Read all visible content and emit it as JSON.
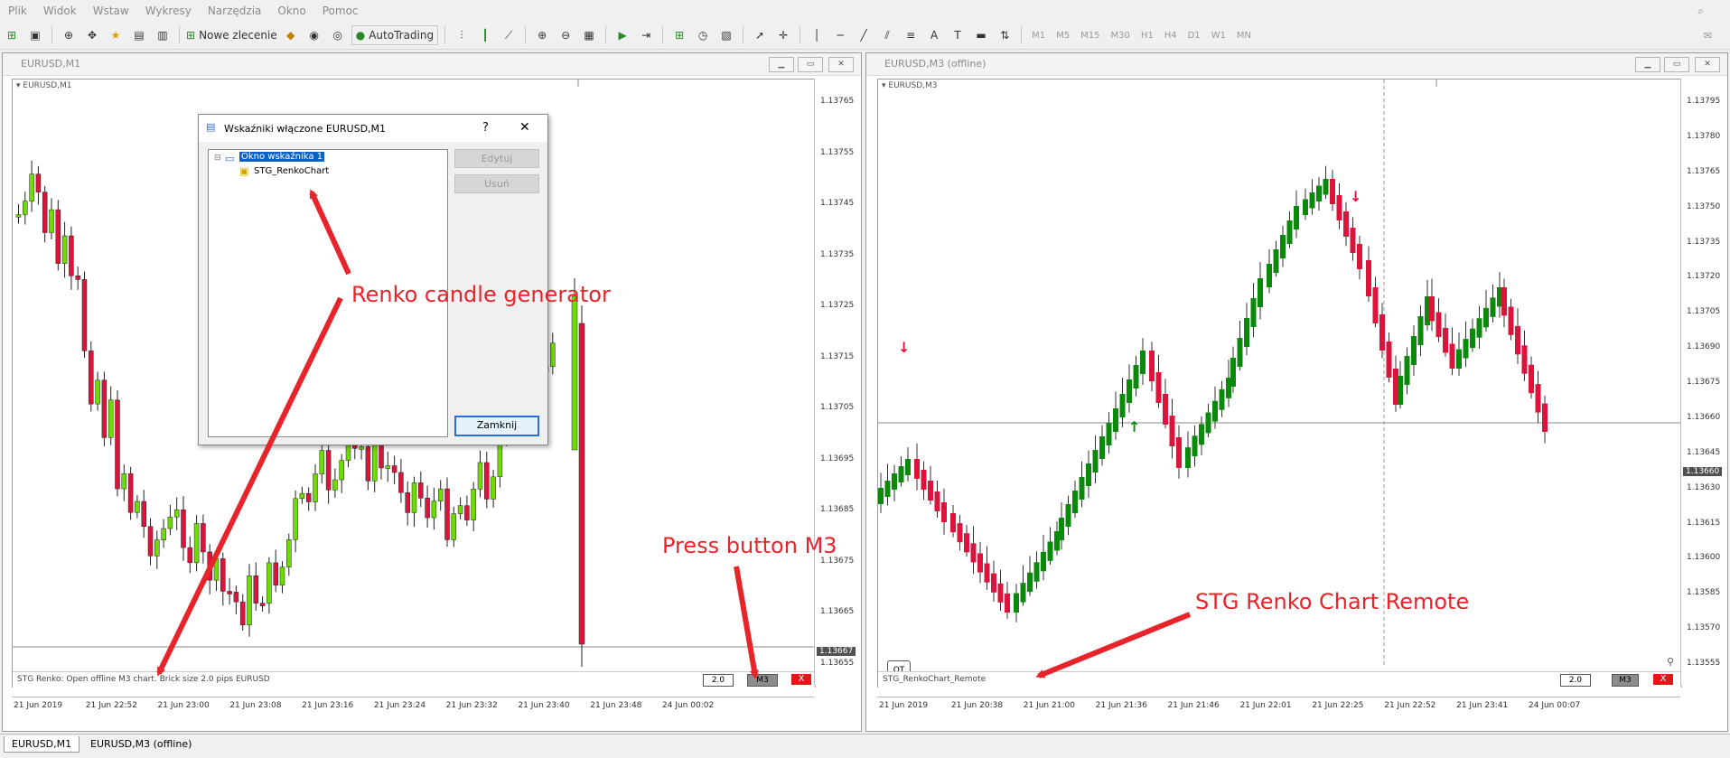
{
  "menu": [
    "Plik",
    "Widok",
    "Wstaw",
    "Wykresy",
    "Narzędzia",
    "Okno",
    "Pomoc"
  ],
  "toolbar": {
    "new_order": "Nowe zlecenie",
    "autotrading": "AutoTrading",
    "timeframes": [
      "M1",
      "M5",
      "M15",
      "M30",
      "H1",
      "H4",
      "D1",
      "W1",
      "MN"
    ]
  },
  "left_window": {
    "title": "EURUSD,M1",
    "chart_symbol": "EURUSD,M1",
    "price_labels": [
      "1.13765",
      "1.13755",
      "1.13745",
      "1.13735",
      "1.13725",
      "1.13715",
      "1.13705",
      "1.13695",
      "1.13685",
      "1.13675",
      "1.13665",
      "1.13655"
    ],
    "current_price": "1.13667",
    "time_labels": [
      "21 Jun 2019",
      "21 Jun 22:52",
      "21 Jun 23:00",
      "21 Jun 23:08",
      "21 Jun 23:16",
      "21 Jun 23:24",
      "21 Jun 23:32",
      "21 Jun 23:40",
      "21 Jun 23:48",
      "24 Jun 00:02"
    ],
    "status_text": "STG Renko: Open offline M3 chart. Brick size 2.0 pips EURUSD",
    "brick_value": "2.0",
    "m3_label": "M3",
    "close_label": "X"
  },
  "right_window": {
    "title": "EURUSD,M3 (offline)",
    "chart_symbol": "EURUSD,M3",
    "price_labels": [
      "1.13795",
      "1.13780",
      "1.13765",
      "1.13750",
      "1.13735",
      "1.13720",
      "1.13705",
      "1.13690",
      "1.13675",
      "1.13660",
      "1.13645",
      "1.13630",
      "1.13615",
      "1.13600",
      "1.13585",
      "1.13570",
      "1.13555"
    ],
    "current_price": "1.13660",
    "time_labels": [
      "21 Jun 2019",
      "21 Jun 20:38",
      "21 Jun 21:00",
      "21 Jun 21:36",
      "21 Jun 21:46",
      "21 Jun 22:01",
      "21 Jun 22:25",
      "21 Jun 22:52",
      "21 Jun 23:41",
      "24 Jun 00:07"
    ],
    "status_text": "STG_RenkoChart_Remote",
    "brick_value": "2.0",
    "m3_label": "M3",
    "close_label": "X",
    "ot_label": "OT"
  },
  "dialog": {
    "title": "Wskaźniki włączone EURUSD,M1",
    "help": "?",
    "close_x": "✕",
    "tree_root": "Okno wskaźnika 1",
    "tree_child": "STG_RenkoChart",
    "edit_button": "Edytuj",
    "delete_button": "Usuń",
    "close_button": "Zamknij"
  },
  "annotations": {
    "renko_generator": "Renko candle generator",
    "press_m3": "Press button M3",
    "renko_remote": "STG Renko Chart Remote"
  },
  "tabs": [
    "EURUSD,M1",
    "EURUSD,M3 (offline)"
  ],
  "colors": {
    "bull": "#0a8a0a",
    "bear": "#dc143c",
    "m1_bull": "#6fdc00",
    "arrow": "#e8242b"
  }
}
